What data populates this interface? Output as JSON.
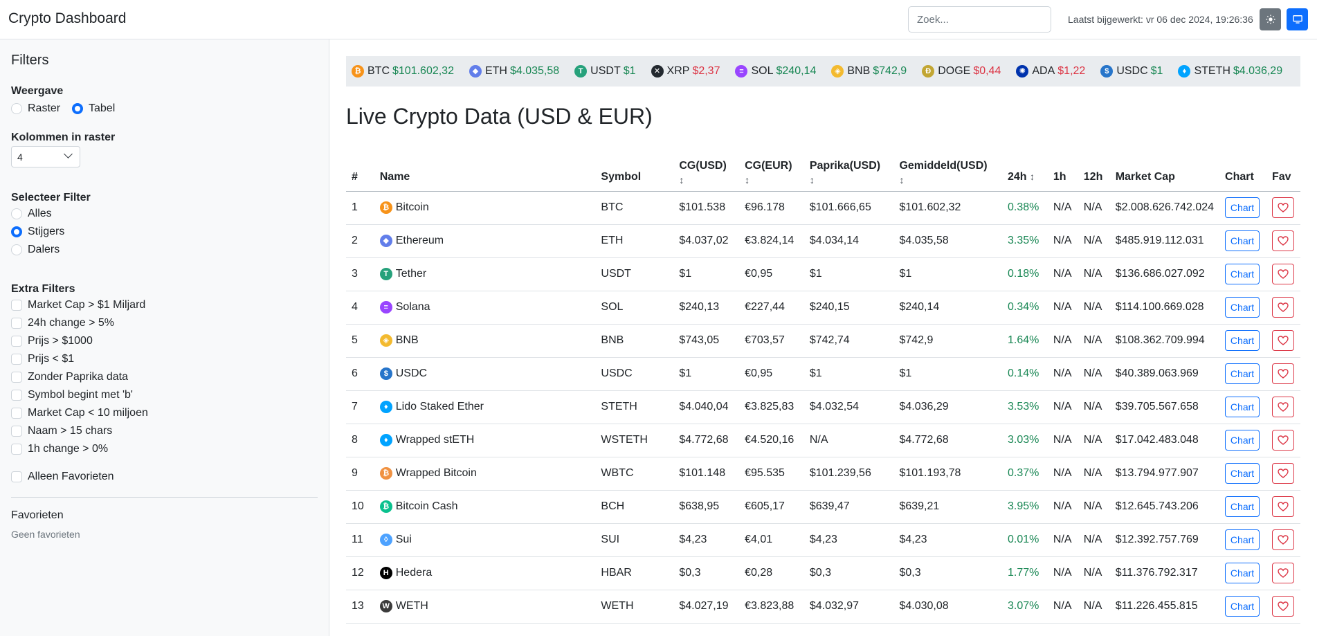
{
  "navbar": {
    "brand": "Crypto Dashboard",
    "search_placeholder": "Zoek...",
    "updated": "Laatst bijgewerkt: vr 06 dec 2024, 19:26:36"
  },
  "sidebar": {
    "title": "Filters",
    "view": {
      "heading": "Weergave",
      "options": [
        "Raster",
        "Tabel"
      ],
      "selected": "Tabel"
    },
    "columns": {
      "heading": "Kolommen in raster",
      "value": "4"
    },
    "filter": {
      "heading": "Selecteer Filter",
      "options": [
        "Alles",
        "Stijgers",
        "Dalers"
      ],
      "selected": "Stijgers"
    },
    "extra": {
      "heading": "Extra Filters",
      "options": [
        "Market Cap > $1 Miljard",
        "24h change > 5%",
        "Prijs > $1000",
        "Prijs < $1",
        "Zonder Paprika data",
        "Symbol begint met 'b'",
        "Market Cap < 10 miljoen",
        "Naam > 15 chars",
        "1h change > 0%"
      ],
      "favorites_only": "Alleen Favorieten"
    },
    "favorites": {
      "heading": "Favorieten",
      "empty": "Geen favorieten"
    }
  },
  "ticker": [
    {
      "symbol": "BTC",
      "price": "$101.602,32",
      "trend": "pos",
      "icon": "bitcoin-icon",
      "color": "#f7931a",
      "glyph": "₿"
    },
    {
      "symbol": "ETH",
      "price": "$4.035,58",
      "trend": "pos",
      "icon": "ethereum-icon",
      "color": "#627eea",
      "glyph": "◆"
    },
    {
      "symbol": "USDT",
      "price": "$1",
      "trend": "pos",
      "icon": "tether-icon",
      "color": "#26a17b",
      "glyph": "T"
    },
    {
      "symbol": "XRP",
      "price": "$2,37",
      "trend": "neg",
      "icon": "xrp-icon",
      "color": "#23292f",
      "glyph": "✕"
    },
    {
      "symbol": "SOL",
      "price": "$240,14",
      "trend": "pos",
      "icon": "solana-icon",
      "color": "#9945ff",
      "glyph": "≡"
    },
    {
      "symbol": "BNB",
      "price": "$742,9",
      "trend": "pos",
      "icon": "bnb-icon",
      "color": "#f3ba2f",
      "glyph": "◈"
    },
    {
      "symbol": "DOGE",
      "price": "$0,44",
      "trend": "neg",
      "icon": "doge-icon",
      "color": "#c2a633",
      "glyph": "Ð"
    },
    {
      "symbol": "ADA",
      "price": "$1,22",
      "trend": "neg",
      "icon": "cardano-icon",
      "color": "#0033ad",
      "glyph": "✺"
    },
    {
      "symbol": "USDC",
      "price": "$1",
      "trend": "pos",
      "icon": "usdc-icon",
      "color": "#2775ca",
      "glyph": "$"
    },
    {
      "symbol": "STETH",
      "price": "$4.036,29",
      "trend": "pos",
      "icon": "steth-icon",
      "color": "#00a3ff",
      "glyph": "♦"
    }
  ],
  "page_title": "Live Crypto Data (USD & EUR)",
  "table": {
    "headers": {
      "rank": "#",
      "name": "Name",
      "symbol": "Symbol",
      "cg_usd": "CG(USD)",
      "cg_eur": "CG(EUR)",
      "paprika": "Paprika(USD)",
      "avg": "Gemiddeld(USD)",
      "h24": "24h",
      "h1": "1h",
      "h12": "12h",
      "mcap": "Market Cap",
      "chart": "Chart",
      "fav": "Fav",
      "sort_arrow": "↕"
    },
    "chart_label": "Chart",
    "rows": [
      {
        "rank": "1",
        "name": "Bitcoin",
        "symbol": "BTC",
        "cg_usd": "$101.538",
        "cg_eur": "€96.178",
        "paprika": "$101.666,65",
        "avg": "$101.602,32",
        "h24": "0.38%",
        "h1": "N/A",
        "h12": "N/A",
        "mcap": "$2.008.626.742.024",
        "icon": "bitcoin-icon",
        "color": "#f7931a",
        "glyph": "₿"
      },
      {
        "rank": "2",
        "name": "Ethereum",
        "symbol": "ETH",
        "cg_usd": "$4.037,02",
        "cg_eur": "€3.824,14",
        "paprika": "$4.034,14",
        "avg": "$4.035,58",
        "h24": "3.35%",
        "h1": "N/A",
        "h12": "N/A",
        "mcap": "$485.919.112.031",
        "icon": "ethereum-icon",
        "color": "#627eea",
        "glyph": "◆"
      },
      {
        "rank": "3",
        "name": "Tether",
        "symbol": "USDT",
        "cg_usd": "$1",
        "cg_eur": "€0,95",
        "paprika": "$1",
        "avg": "$1",
        "h24": "0.18%",
        "h1": "N/A",
        "h12": "N/A",
        "mcap": "$136.686.027.092",
        "icon": "tether-icon",
        "color": "#26a17b",
        "glyph": "T"
      },
      {
        "rank": "4",
        "name": "Solana",
        "symbol": "SOL",
        "cg_usd": "$240,13",
        "cg_eur": "€227,44",
        "paprika": "$240,15",
        "avg": "$240,14",
        "h24": "0.34%",
        "h1": "N/A",
        "h12": "N/A",
        "mcap": "$114.100.669.028",
        "icon": "solana-icon",
        "color": "#9945ff",
        "glyph": "≡"
      },
      {
        "rank": "5",
        "name": "BNB",
        "symbol": "BNB",
        "cg_usd": "$743,05",
        "cg_eur": "€703,57",
        "paprika": "$742,74",
        "avg": "$742,9",
        "h24": "1.64%",
        "h1": "N/A",
        "h12": "N/A",
        "mcap": "$108.362.709.994",
        "icon": "bnb-icon",
        "color": "#f3ba2f",
        "glyph": "◈"
      },
      {
        "rank": "6",
        "name": "USDC",
        "symbol": "USDC",
        "cg_usd": "$1",
        "cg_eur": "€0,95",
        "paprika": "$1",
        "avg": "$1",
        "h24": "0.14%",
        "h1": "N/A",
        "h12": "N/A",
        "mcap": "$40.389.063.969",
        "icon": "usdc-icon",
        "color": "#2775ca",
        "glyph": "$"
      },
      {
        "rank": "7",
        "name": "Lido Staked Ether",
        "symbol": "STETH",
        "cg_usd": "$4.040,04",
        "cg_eur": "€3.825,83",
        "paprika": "$4.032,54",
        "avg": "$4.036,29",
        "h24": "3.53%",
        "h1": "N/A",
        "h12": "N/A",
        "mcap": "$39.705.567.658",
        "icon": "steth-icon",
        "color": "#00a3ff",
        "glyph": "♦"
      },
      {
        "rank": "8",
        "name": "Wrapped stETH",
        "symbol": "WSTETH",
        "cg_usd": "$4.772,68",
        "cg_eur": "€4.520,16",
        "paprika": "N/A",
        "avg": "$4.772,68",
        "h24": "3.03%",
        "h1": "N/A",
        "h12": "N/A",
        "mcap": "$17.042.483.048",
        "icon": "wsteth-icon",
        "color": "#00a3ff",
        "glyph": "♦"
      },
      {
        "rank": "9",
        "name": "Wrapped Bitcoin",
        "symbol": "WBTC",
        "cg_usd": "$101.148",
        "cg_eur": "€95.535",
        "paprika": "$101.239,56",
        "avg": "$101.193,78",
        "h24": "0.37%",
        "h1": "N/A",
        "h12": "N/A",
        "mcap": "$13.794.977.907",
        "icon": "wbtc-icon",
        "color": "#f09242",
        "glyph": "₿"
      },
      {
        "rank": "10",
        "name": "Bitcoin Cash",
        "symbol": "BCH",
        "cg_usd": "$638,95",
        "cg_eur": "€605,17",
        "paprika": "$639,47",
        "avg": "$639,21",
        "h24": "3.95%",
        "h1": "N/A",
        "h12": "N/A",
        "mcap": "$12.645.743.206",
        "icon": "bitcoin-cash-icon",
        "color": "#0ac18e",
        "glyph": "₿"
      },
      {
        "rank": "11",
        "name": "Sui",
        "symbol": "SUI",
        "cg_usd": "$4,23",
        "cg_eur": "€4,01",
        "paprika": "$4,23",
        "avg": "$4,23",
        "h24": "0.01%",
        "h1": "N/A",
        "h12": "N/A",
        "mcap": "$12.392.757.769",
        "icon": "sui-icon",
        "color": "#4da2ff",
        "glyph": "◊"
      },
      {
        "rank": "12",
        "name": "Hedera",
        "symbol": "HBAR",
        "cg_usd": "$0,3",
        "cg_eur": "€0,28",
        "paprika": "$0,3",
        "avg": "$0,3",
        "h24": "1.77%",
        "h1": "N/A",
        "h12": "N/A",
        "mcap": "$11.376.792.317",
        "icon": "hedera-icon",
        "color": "#000000",
        "glyph": "H"
      },
      {
        "rank": "13",
        "name": "WETH",
        "symbol": "WETH",
        "cg_usd": "$4.027,19",
        "cg_eur": "€3.823,88",
        "paprika": "$4.032,97",
        "avg": "$4.030,08",
        "h24": "3.07%",
        "h1": "N/A",
        "h12": "N/A",
        "mcap": "$11.226.455.815",
        "icon": "weth-icon",
        "color": "#3b3b3b",
        "glyph": "W"
      }
    ]
  },
  "colors": {
    "primary": "#0d6efd",
    "positive": "#198754",
    "negative": "#dc3545",
    "sidebar_bg": "#f8f9fa",
    "ticker_bg": "#e9ecef"
  }
}
